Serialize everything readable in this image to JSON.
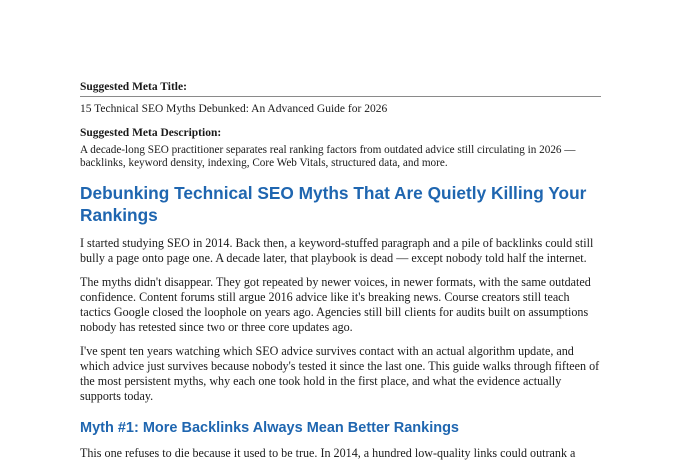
{
  "meta": {
    "title_label": "Suggested Meta Title:",
    "title_value": "15 Technical SEO Myths Debunked: An Advanced Guide for 2026",
    "description_label": "Suggested Meta Description:",
    "description_value": "A decade-long SEO practitioner separates real ranking factors from outdated advice still circulating in 2026 — backlinks, keyword density, indexing, Core Web Vitals, structured data, and more."
  },
  "article": {
    "heading": "Debunking Technical SEO Myths That Are Quietly Killing Your Rankings",
    "paragraphs": [
      "I started studying SEO in 2014. Back then, a keyword-stuffed paragraph and a pile of backlinks could still bully a page onto page one. A decade later, that playbook is dead — except nobody told half the internet.",
      "The myths didn't disappear. They got repeated by newer voices, in newer formats, with the same outdated confidence. Content forums still argue 2016 advice like it's breaking news. Course creators still teach tactics Google closed the loophole on years ago. Agencies still bill clients for audits built on assumptions nobody has retested since two or three core updates ago.",
      "I've spent ten years watching which SEO advice survives contact with an actual algorithm update, and which advice just survives because nobody's tested it since the last one. This guide walks through fifteen of the most persistent myths, why each one took hold in the first place, and what the evidence actually supports today."
    ],
    "myth1_heading": "Myth #1: More Backlinks Always Mean Better Rankings",
    "myth1_paragraph": "This one refuses to die because it used to be true. In 2014, a hundred low-quality links could outrank a"
  }
}
